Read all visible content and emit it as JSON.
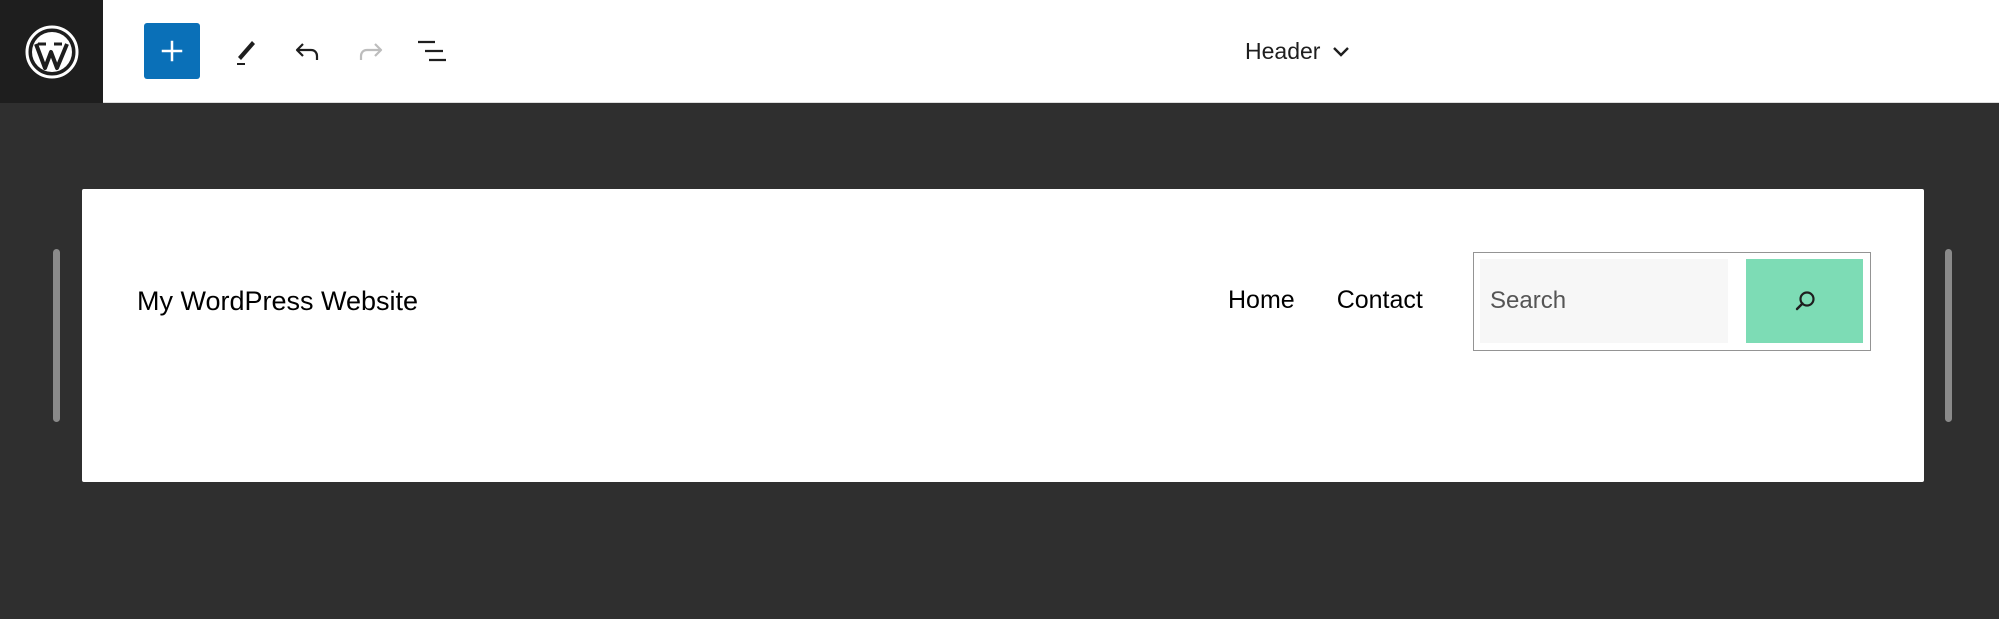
{
  "toolbar": {
    "logo_icon": "wordpress-logo-icon",
    "inserter_icon": "plus-icon",
    "tools": [
      "pencil-icon",
      "undo-icon",
      "redo-icon",
      "list-view-icon"
    ],
    "document_title": "Header",
    "document_title_icon": "chevron-down-icon"
  },
  "header_template": {
    "site_title": "My WordPress Website",
    "nav_items": [
      "Home",
      "Contact"
    ],
    "search": {
      "placeholder": "Search",
      "button_icon": "search-icon"
    }
  },
  "colors": {
    "topbar_bg": "#ffffff",
    "logo_bg": "#1e1e1e",
    "accent": "#0a70b8",
    "canvas_bg": "#2f2f2f",
    "search_button": "#7ddcb5"
  }
}
